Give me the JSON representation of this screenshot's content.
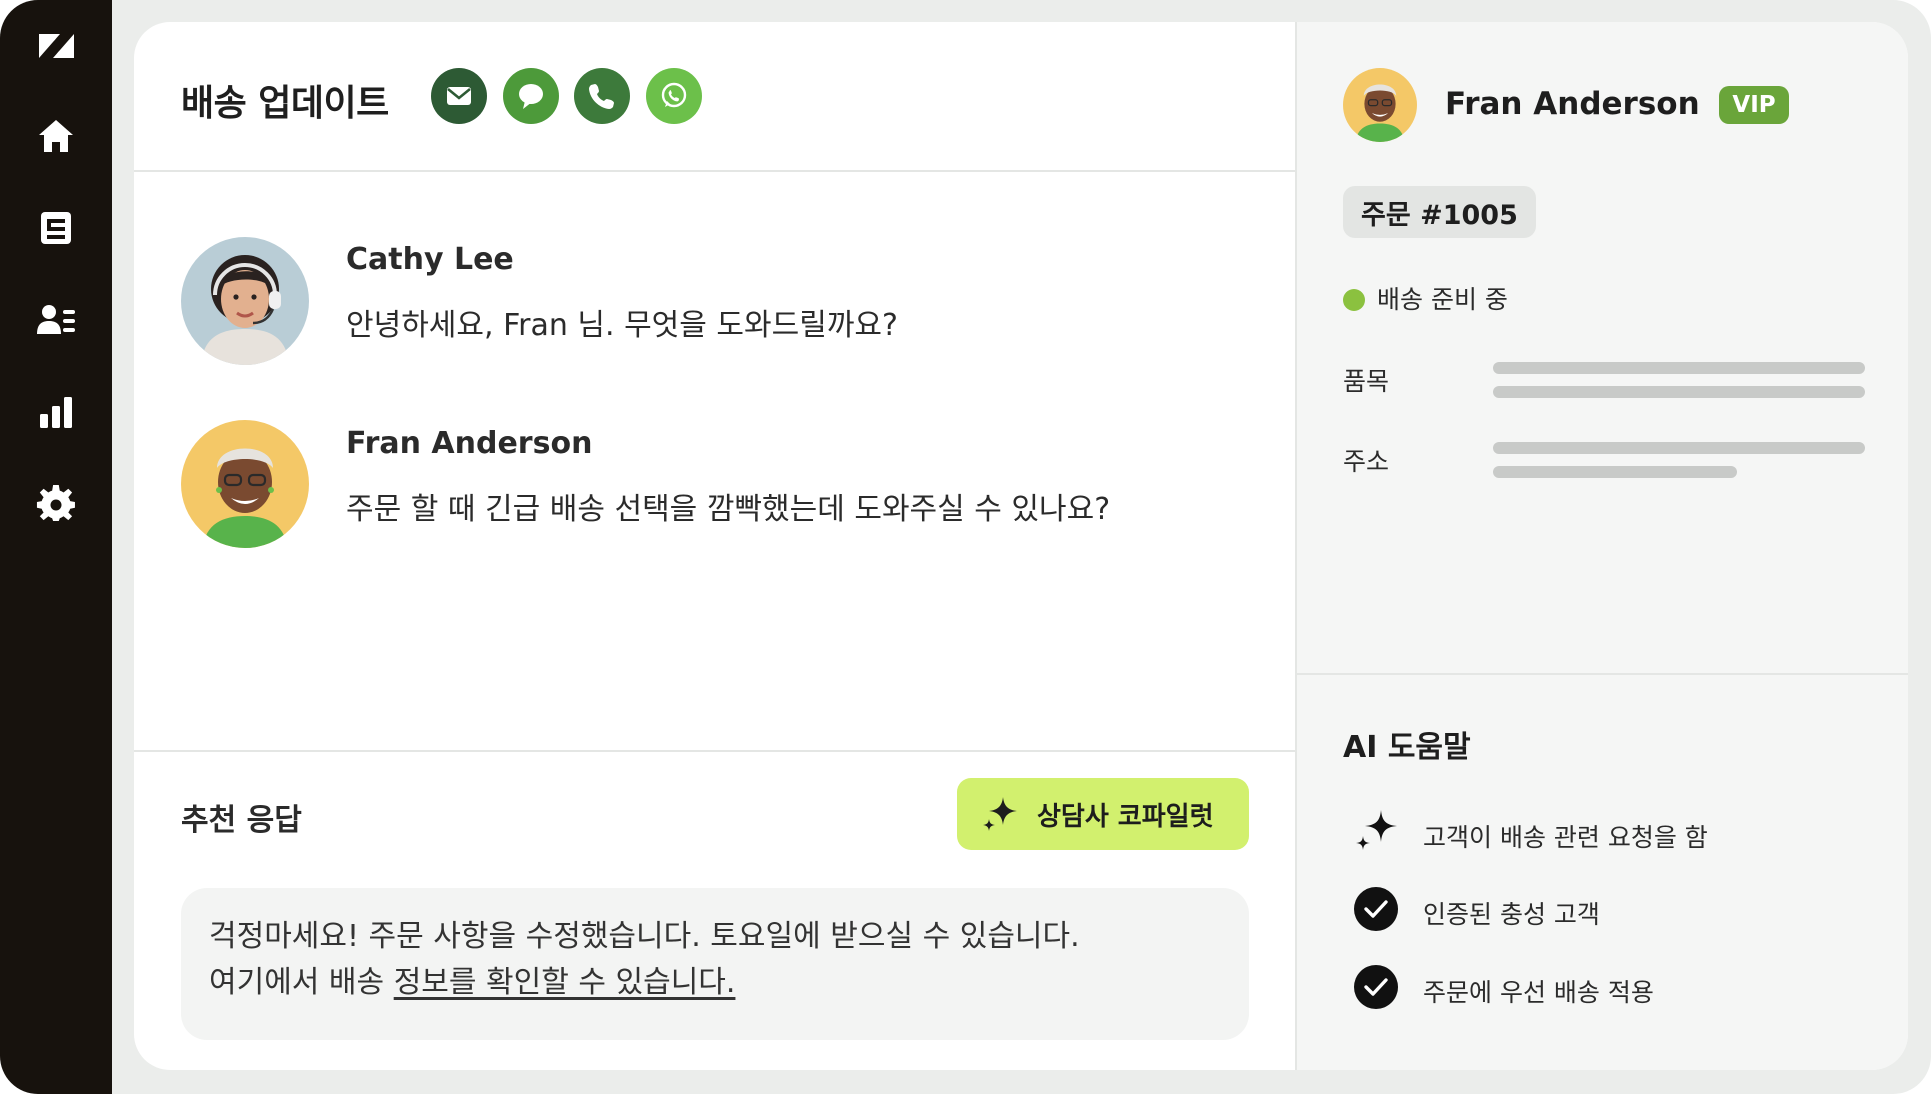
{
  "sidebar": {
    "items": [
      {
        "icon": "zendesk-logo-icon"
      },
      {
        "icon": "home-icon"
      },
      {
        "icon": "tickets-icon"
      },
      {
        "icon": "customers-icon"
      },
      {
        "icon": "reports-icon"
      },
      {
        "icon": "settings-icon"
      }
    ]
  },
  "conversation": {
    "title": "배송 업데이트",
    "channels": [
      {
        "icon": "email-icon",
        "color": "#2d5a34"
      },
      {
        "icon": "chat-icon",
        "color": "#4d9a3a"
      },
      {
        "icon": "phone-icon",
        "color": "#3d7a3b"
      },
      {
        "icon": "whatsapp-icon",
        "color": "#6cc04a"
      }
    ],
    "messages": [
      {
        "name": "Cathy Lee",
        "text": "안녕하세요, Fran 님. 무엇을 도와드릴까요?"
      },
      {
        "name": "Fran Anderson",
        "text": "주문 할 때 긴급 배송 선택을 깜빡했는데 도와주실 수 있나요?"
      }
    ]
  },
  "suggestion": {
    "title": "추천 응답",
    "copilot_label": "상담사 코파일럿",
    "reply_line1": "걱정마세요! 주문 사항을 수정했습니다. 토요일에 받으실 수 있습니다.",
    "reply_line2_prefix": "여기에서 배송 ",
    "reply_line2_link": "정보를 확인할 수 있습니다."
  },
  "customer": {
    "name": "Fran Anderson",
    "badge": "VIP",
    "order": "주문 #1005",
    "status": "배송 준비 중",
    "status_color": "#8bc13f",
    "fields": {
      "item_label": "품목",
      "address_label": "주소"
    }
  },
  "ai_help": {
    "title": "AI 도움말",
    "items": [
      {
        "icon": "sparkle-icon",
        "text": "고객이 배송 관련 요청을 함"
      },
      {
        "icon": "check-circle-icon",
        "text": "인증된 충성 고객"
      },
      {
        "icon": "check-circle-icon",
        "text": "주문에 우선 배송 적용"
      }
    ]
  },
  "colors": {
    "sidebar_bg": "#17120d",
    "accent_lime": "#d2f06e",
    "vip_green": "#6aa53a"
  }
}
